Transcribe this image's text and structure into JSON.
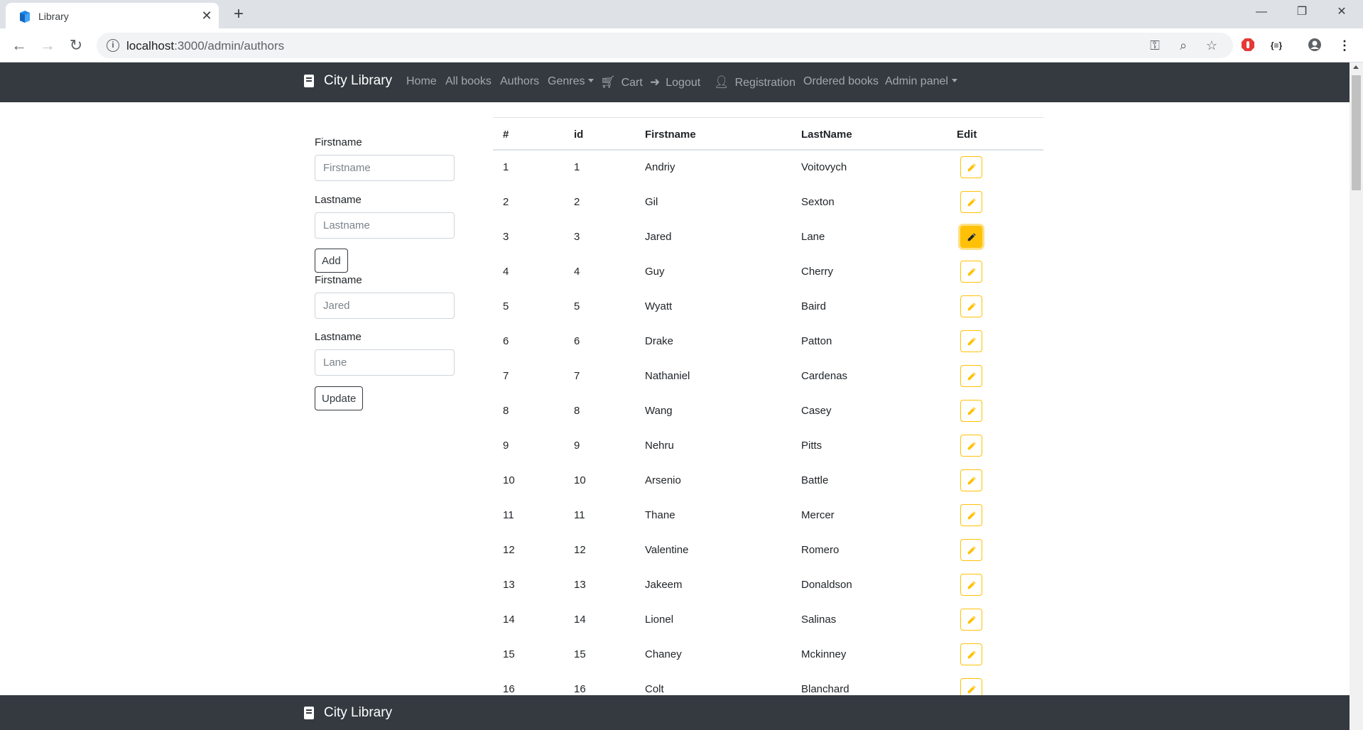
{
  "browser": {
    "tab_title": "Library",
    "url_host": "localhost",
    "url_path": ":3000/admin/authors",
    "extension_badge": "{≡}"
  },
  "navbar": {
    "brand": "City Library",
    "links": {
      "home": "Home",
      "all_books": "All books",
      "authors": "Authors",
      "genres": "Genres",
      "cart": "Cart",
      "logout": "Logout",
      "registration": "Registration",
      "ordered_books": "Ordered books",
      "admin_panel": "Admin panel"
    }
  },
  "add_form": {
    "firstname_label": "Firstname",
    "firstname_placeholder": "Firstname",
    "lastname_label": "Lastname",
    "lastname_placeholder": "Lastname",
    "submit_label": "Add"
  },
  "update_form": {
    "firstname_label": "Firstname",
    "firstname_placeholder": "Jared",
    "lastname_label": "Lastname",
    "lastname_placeholder": "Lane",
    "submit_label": "Update"
  },
  "table": {
    "headers": {
      "num": "#",
      "id": "id",
      "firstname": "Firstname",
      "lastname": "LastName",
      "edit": "Edit"
    },
    "rows": [
      {
        "num": "1",
        "id": "1",
        "first": "Andriy",
        "last": "Voitovych"
      },
      {
        "num": "2",
        "id": "2",
        "first": "Gil",
        "last": "Sexton"
      },
      {
        "num": "3",
        "id": "3",
        "first": "Jared",
        "last": "Lane"
      },
      {
        "num": "4",
        "id": "4",
        "first": "Guy",
        "last": "Cherry"
      },
      {
        "num": "5",
        "id": "5",
        "first": "Wyatt",
        "last": "Baird"
      },
      {
        "num": "6",
        "id": "6",
        "first": "Drake",
        "last": "Patton"
      },
      {
        "num": "7",
        "id": "7",
        "first": "Nathaniel",
        "last": "Cardenas"
      },
      {
        "num": "8",
        "id": "8",
        "first": "Wang",
        "last": "Casey"
      },
      {
        "num": "9",
        "id": "9",
        "first": "Nehru",
        "last": "Pitts"
      },
      {
        "num": "10",
        "id": "10",
        "first": "Arsenio",
        "last": "Battle"
      },
      {
        "num": "11",
        "id": "11",
        "first": "Thane",
        "last": "Mercer"
      },
      {
        "num": "12",
        "id": "12",
        "first": "Valentine",
        "last": "Romero"
      },
      {
        "num": "13",
        "id": "13",
        "first": "Jakeem",
        "last": "Donaldson"
      },
      {
        "num": "14",
        "id": "14",
        "first": "Lionel",
        "last": "Salinas"
      },
      {
        "num": "15",
        "id": "15",
        "first": "Chaney",
        "last": "Mckinney"
      },
      {
        "num": "16",
        "id": "16",
        "first": "Colt",
        "last": "Blanchard"
      }
    ],
    "active_edit_row": 3
  },
  "footer": {
    "brand": "City Library"
  },
  "colors": {
    "navbar_bg": "#343a40",
    "edit_accent": "#ffc107"
  }
}
